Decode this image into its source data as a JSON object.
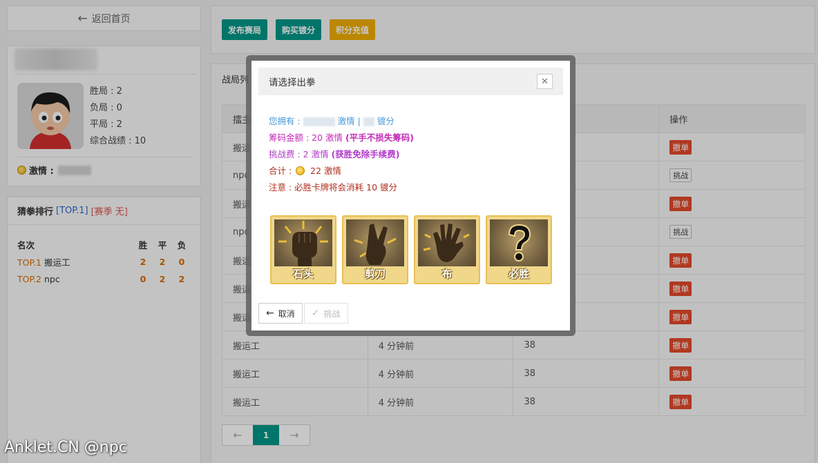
{
  "nav": {
    "back_label": "返回首页"
  },
  "profile": {
    "stats": [
      {
        "label": "胜局 : 2"
      },
      {
        "label": "负局 : 0"
      },
      {
        "label": "平局 : 2"
      },
      {
        "label": "综合战绩 : 10"
      }
    ],
    "coin_label": "激情 :"
  },
  "ranking": {
    "title": "猜拳排行",
    "top_tag": "[TOP.1]",
    "season_tag": "[赛季 无]",
    "headers": {
      "rank": "名次",
      "win": "胜",
      "draw": "平",
      "lose": "负"
    },
    "rows": [
      {
        "tag": "TOP.1",
        "name": "搬运工",
        "win": "2",
        "draw": "2",
        "lose": "0"
      },
      {
        "tag": "TOP.2",
        "name": "npc",
        "win": "0",
        "draw": "2",
        "lose": "2"
      }
    ]
  },
  "toolbar": {
    "publish": "发布赛局",
    "buy": "购买镀分",
    "recharge": "积分充值"
  },
  "list": {
    "title": "战局列",
    "headers": {
      "host": "擂主",
      "action": "操作"
    },
    "rows": [
      {
        "host": "搬运",
        "time": "",
        "score": "",
        "action": "撤单",
        "type": "red"
      },
      {
        "host": "npc",
        "time": "",
        "score": "",
        "action": "挑战",
        "type": "gray"
      },
      {
        "host": "搬运",
        "time": "",
        "score": "",
        "action": "撤单",
        "type": "red"
      },
      {
        "host": "npc",
        "time": "",
        "score": "",
        "action": "挑战",
        "type": "gray"
      },
      {
        "host": "搬运",
        "time": "",
        "score": "",
        "action": "撤单",
        "type": "red"
      },
      {
        "host": "搬运",
        "time": "",
        "score": "",
        "action": "撤单",
        "type": "red"
      },
      {
        "host": "搬运",
        "time": "",
        "score": "",
        "action": "撤单",
        "type": "red"
      },
      {
        "host": "搬运工",
        "time": "4 分钟前",
        "score": "38",
        "action": "撤单",
        "type": "red"
      },
      {
        "host": "搬运工",
        "time": "4 分钟前",
        "score": "38",
        "action": "撤单",
        "type": "red"
      },
      {
        "host": "搬运工",
        "time": "4 分钟前",
        "score": "38",
        "action": "撤单",
        "type": "red"
      }
    ],
    "pager": {
      "prev": "←",
      "current": "1",
      "next": "→"
    }
  },
  "dialog": {
    "title": "请选择出拳",
    "own_prefix": "您拥有 :",
    "own_mid": "激情 |",
    "own_suffix": "镀分",
    "stake": "筹码金额 : 20 激情",
    "stake_note": "(平手不损失筹码)",
    "fee": "挑战费 : 2 激情",
    "fee_note": "(获胜免除手续费)",
    "total_prefix": "合计 :",
    "total_value": "22 激情",
    "warning": "注意 : 必胜卡牌将会消耗 10 镀分",
    "cards": [
      {
        "label": "石头",
        "icon": "fist-icon"
      },
      {
        "label": "剪刀",
        "icon": "scissors-hand-icon"
      },
      {
        "label": "布",
        "icon": "open-hand-icon"
      },
      {
        "label": "必胜",
        "icon": "question-mark-icon"
      }
    ],
    "cancel": "取消",
    "challenge": "挑战"
  },
  "watermark": "Anklet.CN @npc",
  "colors": {
    "accent": "#009688",
    "orange": "#f0ad00",
    "danger": "#e2492a"
  }
}
